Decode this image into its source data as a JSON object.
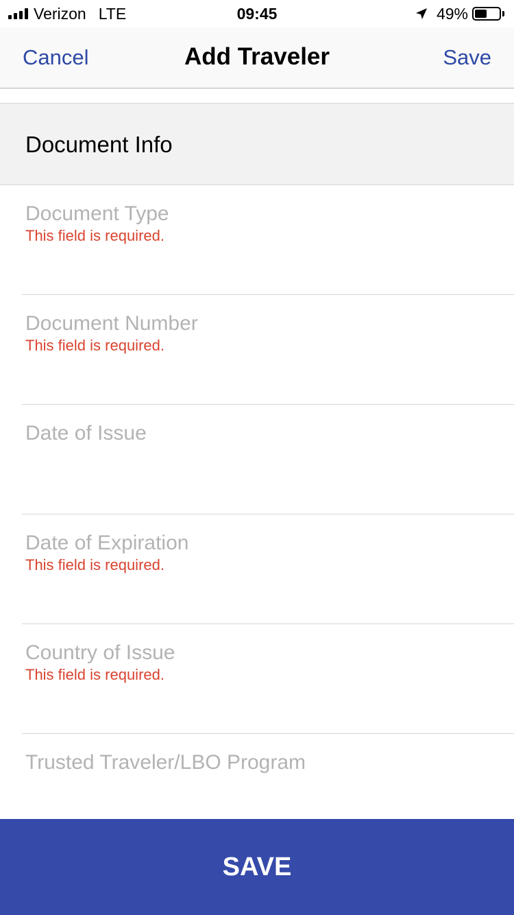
{
  "status_bar": {
    "carrier": "Verizon",
    "network": "LTE",
    "time": "09:45",
    "battery_percent": "49%",
    "battery_level": 0.49,
    "signal_bars": 4,
    "icons": [
      "signal-icon",
      "location-arrow-icon",
      "battery-icon"
    ]
  },
  "nav": {
    "cancel_label": "Cancel",
    "title": "Add Traveler",
    "save_label": "Save"
  },
  "section": {
    "title": "Document Info"
  },
  "fields": [
    {
      "label": "Document Type",
      "error": "This field is required."
    },
    {
      "label": "Document Number",
      "error": "This field is required."
    },
    {
      "label": "Date of Issue",
      "error": ""
    },
    {
      "label": "Date of Expiration",
      "error": "This field is required."
    },
    {
      "label": "Country of Issue",
      "error": "This field is required."
    },
    {
      "label": "Trusted Traveler/LBO Program",
      "error": ""
    }
  ],
  "footer": {
    "save_button_label": "SAVE"
  },
  "colors": {
    "accent": "#2f49a6",
    "save_bar": "#364aaa",
    "error": "#d9432f",
    "placeholder": "#b3b3b3",
    "section_bg": "#f2f2f2"
  }
}
